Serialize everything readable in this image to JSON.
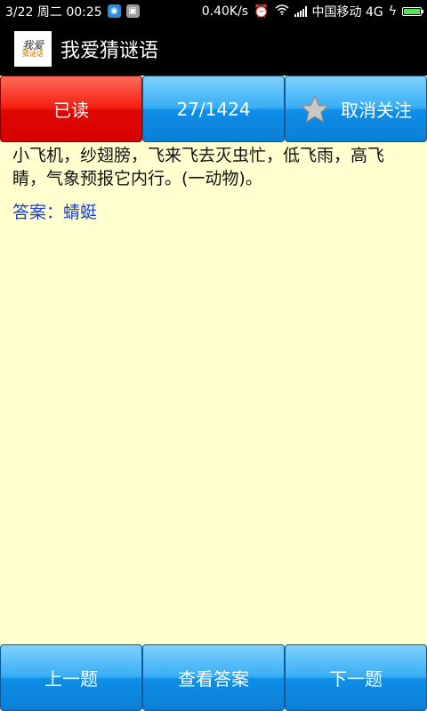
{
  "status_bar": {
    "datetime": "3/22 周二 00:25",
    "net_speed": "0.40K/s",
    "carrier": "中国移动 4G"
  },
  "app": {
    "title": "我爱猜谜语",
    "logo_line1": "我爱",
    "logo_line2": "猜谜语"
  },
  "toolbar": {
    "read_label": "已读",
    "progress_label": "27/1424",
    "unfollow_label": "取消关注"
  },
  "riddle": {
    "question": "小飞机，纱翅膀，飞来飞去灭虫忙，低飞雨，高飞睛，气象预报它内行。(一动物)。",
    "answer": "答案：蜻蜓"
  },
  "bottom_nav": {
    "prev_label": "上一题",
    "show_answer_label": "查看答案",
    "next_label": "下一题"
  },
  "colors": {
    "read_button": "#e00800",
    "button_blue": "#2aa6f0",
    "content_bg": "#ffffd0",
    "answer_text": "#1a3fcf"
  }
}
